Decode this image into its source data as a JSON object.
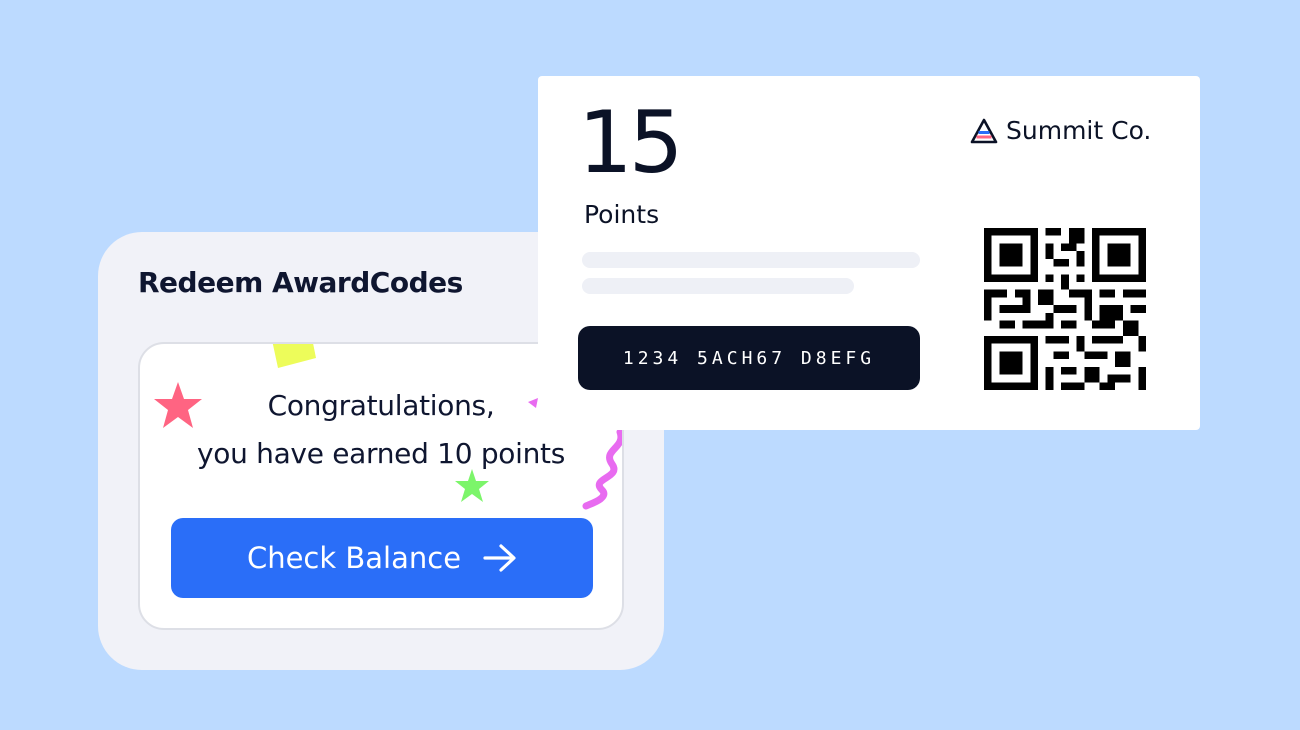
{
  "redeem": {
    "title": "Redeem AwardCodes",
    "message_line1": "Congratulations,",
    "message_line2": "you have earned 10 points",
    "button_label": "Check Balance",
    "button_icon": "arrow-right-icon"
  },
  "points_card": {
    "points_value": "15",
    "points_label": "Points",
    "code": "1234  5ACH67  D8EFG",
    "brand_name": "Summit Co.",
    "brand_icon": "summit-triangle-logo",
    "qr_icon": "qr-code-icon"
  },
  "colors": {
    "background": "#bcdaff",
    "panel": "#f1f2f8",
    "accent": "#2a6ef8",
    "dark": "#0b1226",
    "confetti_star_pink": "#ff6482",
    "confetti_star_green": "#7cf56a",
    "confetti_square_yellow": "#edfc5a",
    "confetti_squiggle_magenta": "#e86bf0"
  }
}
